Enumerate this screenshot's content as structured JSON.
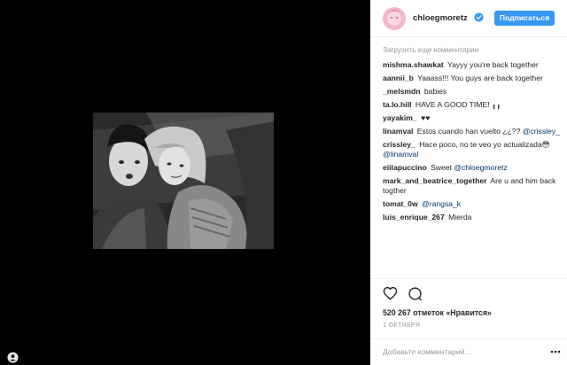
{
  "post": {
    "photo_alt": "",
    "header": {
      "username": "chloegmoretz",
      "follow_label": "Подписаться",
      "verified_icon": "verified-badge-icon"
    },
    "load_more": "Загрузить еще комментарии",
    "comments": [
      {
        "user": "mishma.shawkat",
        "text": "Yayyy you're back together",
        "mention": ""
      },
      {
        "user": "aannii_b",
        "text": "Yaaass!!! You guys are back together",
        "mention": ""
      },
      {
        "user": "_melsmdn",
        "text": "babies",
        "mention": ""
      },
      {
        "user": "ta.lo.hill",
        "text": "HAVE A GOOD TIME! ╻╻",
        "mention": ""
      },
      {
        "user": "yayakim_",
        "text": "♥♥",
        "mention": ""
      },
      {
        "user": "linamval",
        "text": "Estos cuando han vuelto ¿¿??",
        "mention": "@crissley_"
      },
      {
        "user": "crissley_",
        "text": "Hace poco, no te veo yo actualizada😳",
        "mention": "@linamval"
      },
      {
        "user": "eiilapuccino",
        "text": "Sweet",
        "mention": "@chloegmoretz"
      },
      {
        "user": "mark_and_beatrice_together",
        "text": "Are u and him back togther",
        "mention": ""
      },
      {
        "user": "tomat_0w",
        "text": "",
        "mention": "@rangsa_k"
      },
      {
        "user": "luis_enrique_267",
        "text": "Mierda",
        "mention": ""
      }
    ],
    "likes": "520 267 отметок «Нравится»",
    "date": "1 ОКТЯБРЯ",
    "add_comment_placeholder": "Добавьте комментарий...",
    "icons": {
      "like": "heart-icon",
      "comment": "comment-bubble-icon",
      "more": "more-options-icon",
      "tagged": "tagged-user-icon"
    },
    "colors": {
      "follow_button": "#3897f0",
      "mention": "#003569",
      "meta": "#999999"
    }
  }
}
